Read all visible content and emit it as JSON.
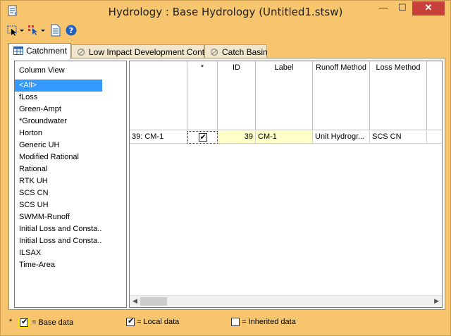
{
  "window": {
    "title": "Hydrology : Base Hydrology (Untitled1.stsw)",
    "minimize_label": "—",
    "maximize_label": "☐",
    "close_label": "✕"
  },
  "toolbar": {
    "icons": [
      "select-icon",
      "dropdown-arrow-icon",
      "pointer-select-icon",
      "dropdown-arrow-icon",
      "document-icon",
      "help-icon"
    ]
  },
  "tabs": [
    {
      "label": "Catchment",
      "active": true
    },
    {
      "label": "Low Impact Development Control",
      "active": false
    },
    {
      "label": "Catch Basin",
      "active": false
    }
  ],
  "column_view": {
    "header": "Column View",
    "items": [
      "<All>",
      "fLoss",
      "Green-Ampt",
      "*Groundwater",
      "Horton",
      "Generic UH",
      "Modified Rational",
      "Rational",
      "RTK UH",
      "SCS CN",
      "SCS UH",
      "SWMM-Runoff",
      "Initial Loss and Consta...",
      "Initial Loss and Consta...",
      "ILSAX",
      "Time-Area"
    ],
    "selected_index": 0
  },
  "grid": {
    "columns": [
      "",
      "*",
      "ID",
      "Label",
      "Runoff Method",
      "Loss Method",
      ""
    ],
    "rows": [
      {
        "row_header": "39: CM-1",
        "checked": true,
        "id": "39",
        "label": "CM-1",
        "runoff_method": "Unit Hydrogr...",
        "loss_method": "SCS CN",
        "extra": ""
      }
    ]
  },
  "legend": {
    "star": "*",
    "base": "= Base data",
    "local": "= Local data",
    "inherited": "= Inherited data"
  },
  "colors": {
    "frame": "#f6c56e",
    "selection": "#3399ff",
    "local_cell": "#ffffc8",
    "close_button": "#c7403a"
  }
}
